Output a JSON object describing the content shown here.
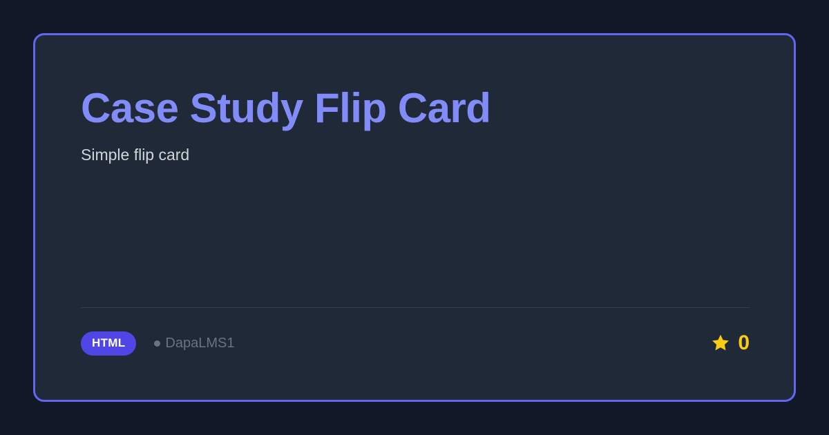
{
  "card": {
    "title": "Case Study Flip Card",
    "description": "Simple flip card",
    "language": "HTML",
    "owner": "DapaLMS1",
    "stars": "0",
    "star_icon": "star-icon",
    "owner_dot_icon": "dot-icon"
  },
  "colors": {
    "background": "#111827",
    "card": "#1f2937",
    "border": "#6366f1",
    "title": "#818cf8",
    "badge": "#4f46e5",
    "star": "#facc15"
  }
}
